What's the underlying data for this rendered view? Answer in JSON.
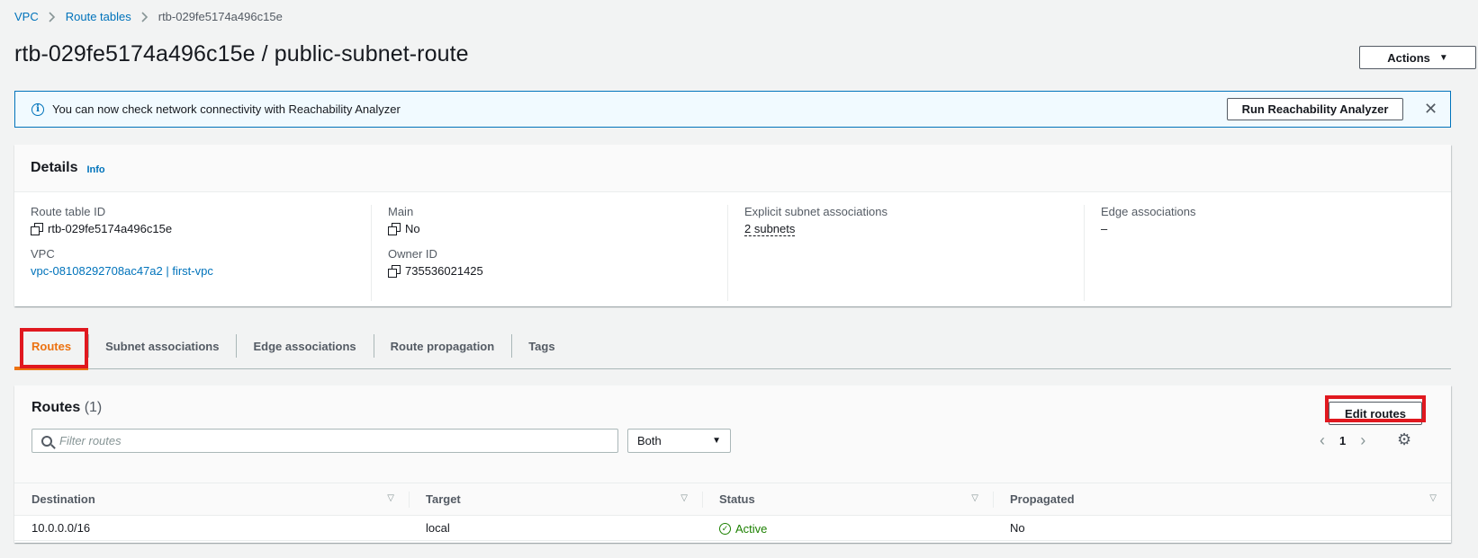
{
  "breadcrumb": {
    "items": [
      "VPC",
      "Route tables"
    ],
    "current": "rtb-029fe5174a496c15e"
  },
  "header": {
    "title": "rtb-029fe5174a496c15e / public-subnet-route",
    "actions_label": "Actions"
  },
  "flash": {
    "message": "You can now check network connectivity with Reachability Analyzer",
    "button_label": "Run Reachability Analyzer"
  },
  "details": {
    "title": "Details",
    "info_label": "Info",
    "route_table_id_label": "Route table ID",
    "route_table_id": "rtb-029fe5174a496c15e",
    "vpc_label": "VPC",
    "vpc_value": "vpc-08108292708ac47a2 | first-vpc",
    "main_label": "Main",
    "main_value": "No",
    "owner_label": "Owner ID",
    "owner_value": "735536021425",
    "explicit_label": "Explicit subnet associations",
    "explicit_value": "2 subnets",
    "edge_label": "Edge associations",
    "edge_value": "–"
  },
  "tabs": [
    {
      "label": "Routes"
    },
    {
      "label": "Subnet associations"
    },
    {
      "label": "Edge associations"
    },
    {
      "label": "Route propagation"
    },
    {
      "label": "Tags"
    }
  ],
  "routes": {
    "title": "Routes",
    "count": "(1)",
    "edit_label": "Edit routes",
    "filter_placeholder": "Filter routes",
    "filter_value": "",
    "select_value": "Both",
    "page": "1",
    "columns": [
      "Destination",
      "Target",
      "Status",
      "Propagated"
    ],
    "rows": [
      {
        "destination": "10.0.0.0/16",
        "target": "local",
        "status": "Active",
        "propagated": "No"
      }
    ]
  },
  "colors": {
    "accent": "#ec7211",
    "link": "#0073bb",
    "success": "#1d8102",
    "highlight": "#e0181f"
  }
}
